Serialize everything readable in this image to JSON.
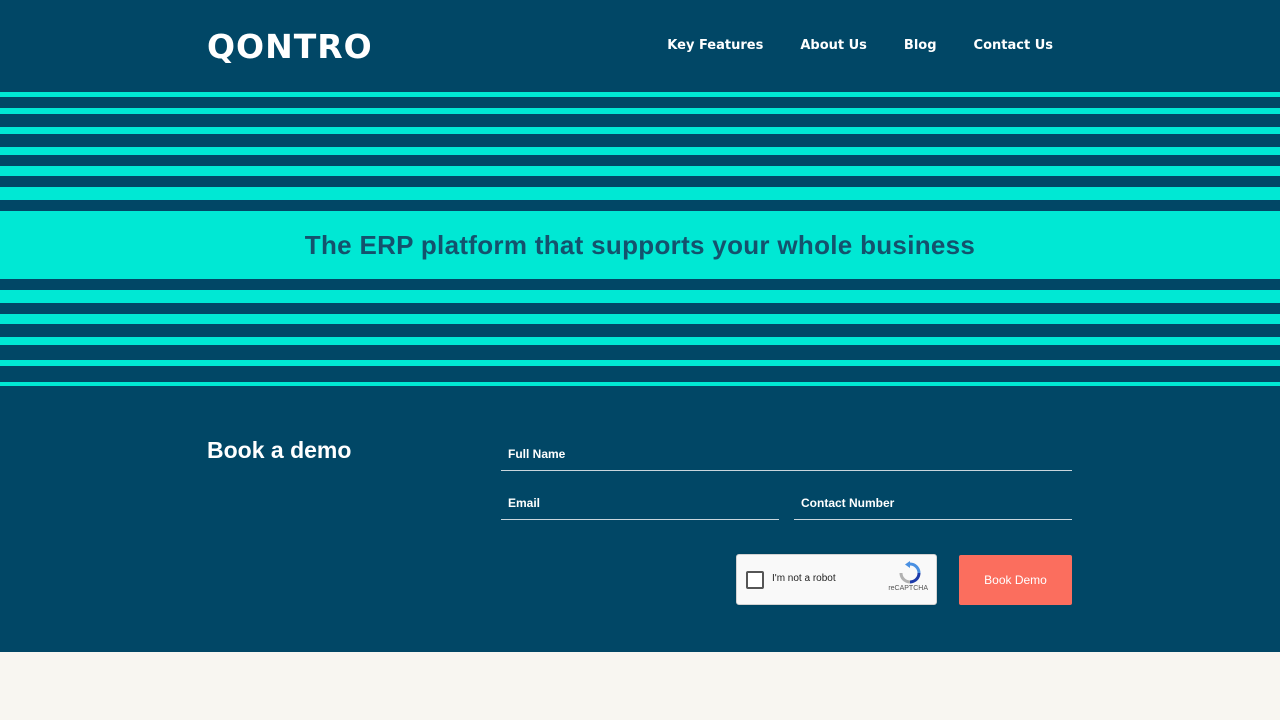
{
  "header": {
    "logo": "QONTRO",
    "nav": [
      {
        "label": "Key Features"
      },
      {
        "label": "About Us"
      },
      {
        "label": "Blog"
      },
      {
        "label": "Contact Us"
      }
    ]
  },
  "hero": {
    "title": "The ERP platform that supports your whole business"
  },
  "demo": {
    "title": "Book a demo",
    "fields": {
      "full_name": {
        "placeholder": "Full Name",
        "value": ""
      },
      "email": {
        "placeholder": "Email",
        "value": ""
      },
      "contact_number": {
        "placeholder": "Contact Number",
        "value": ""
      }
    },
    "captcha": {
      "label": "I'm not a robot",
      "brand": "reCAPTCHA"
    },
    "submit_label": "Book Demo"
  },
  "colors": {
    "navy": "#014766",
    "aqua": "#00e8d4",
    "coral": "#fb6e5e",
    "cream": "#f8f6f1"
  },
  "icons": {
    "captcha_logo": "recaptcha-icon"
  }
}
